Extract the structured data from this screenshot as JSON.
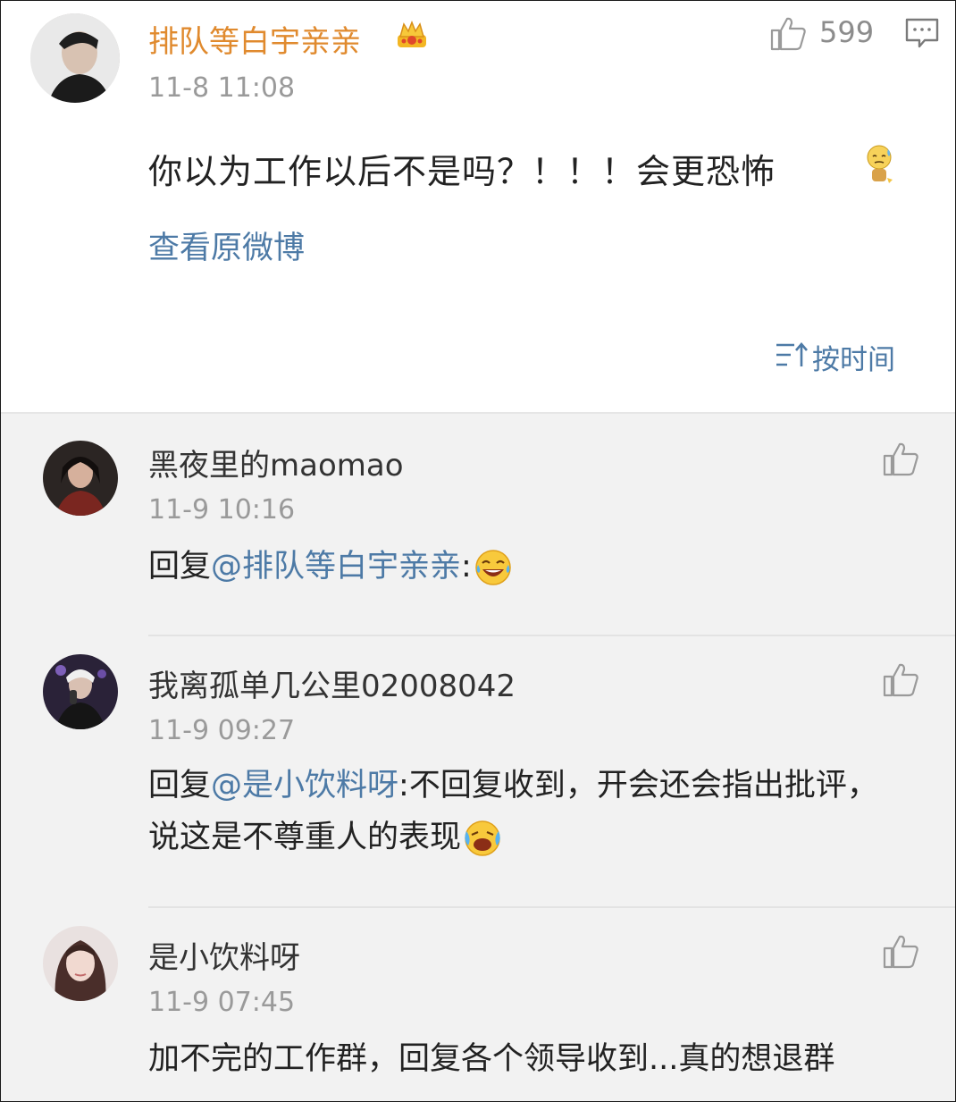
{
  "post": {
    "author": "排队等白宇亲亲",
    "time": "11-8 11:08",
    "like_count": "599",
    "content": "你以为工作以后不是吗？！！！会更恐怖",
    "view_original": "查看原微博",
    "sort_label": "按时间"
  },
  "comments": [
    {
      "name": "黑夜里的maomao",
      "time": "11-9 10:16",
      "reply_prefix": "回复",
      "mention": "@排队等白宇亲亲",
      "text": ":"
    },
    {
      "name": "我离孤单几公里02008042",
      "time": "11-9 09:27",
      "reply_prefix": "回复",
      "mention": "@是小饮料呀",
      "text": ":不回复收到，开会还会指出批评，说这是不尊重人的表现"
    },
    {
      "name": "是小饮料呀",
      "time": "11-9 07:45",
      "text": "加不完的工作群，回复各个领导收到...真的想退群"
    }
  ],
  "colors": {
    "author_name": "#e08a2e",
    "link_blue": "#4d7aa6",
    "meta_gray": "#9a9a9a",
    "list_background": "#f2f2f2"
  },
  "icons": [
    "crown-badge-icon",
    "thumbs-up-icon",
    "comment-icon",
    "sort-icon",
    "laughing-tears-emoji",
    "crying-laugh-emoji",
    "sweat-emoji"
  ]
}
